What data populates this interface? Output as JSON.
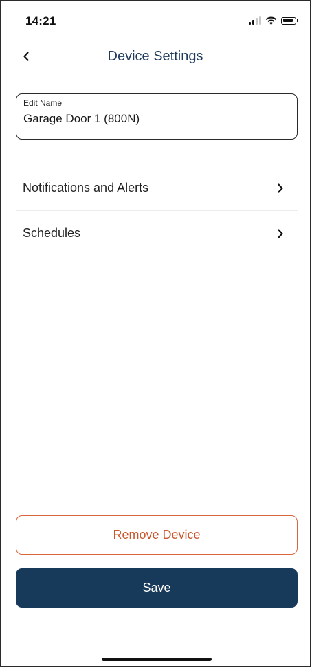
{
  "status_bar": {
    "time": "14:21",
    "icons": [
      "cellular-signal-icon",
      "wifi-icon",
      "battery-icon"
    ]
  },
  "header": {
    "back_icon": "chevron-left-icon",
    "title": "Device Settings"
  },
  "edit_name": {
    "label": "Edit Name",
    "value": "Garage Door 1 (800N)"
  },
  "settings_list": {
    "items": [
      {
        "label": "Notifications and Alerts",
        "icon": "chevron-right-icon"
      },
      {
        "label": "Schedules",
        "icon": "chevron-right-icon"
      }
    ]
  },
  "actions": {
    "remove_label": "Remove Device",
    "save_label": "Save"
  },
  "colors": {
    "title": "#1e3a5c",
    "remove_accent": "#d9663c",
    "save_background": "#173a5b"
  }
}
